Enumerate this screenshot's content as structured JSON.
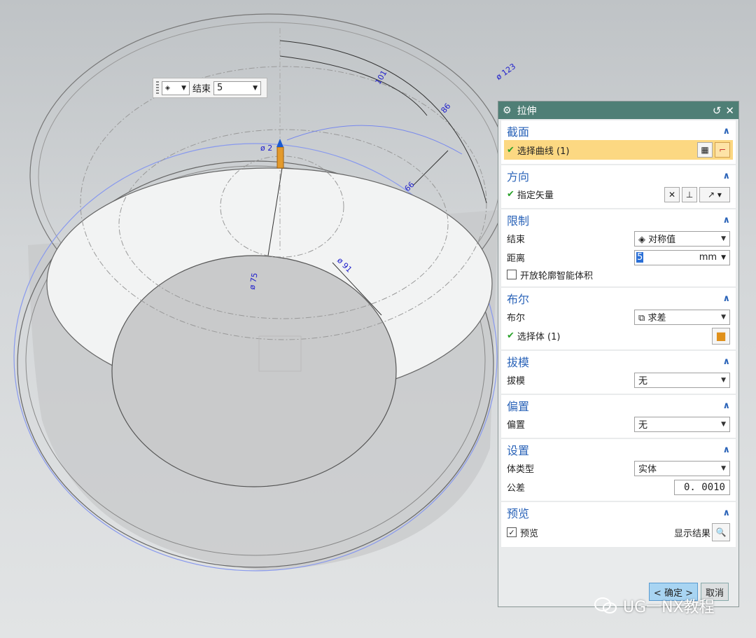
{
  "floating_toolbar": {
    "label": "结束",
    "value": "5"
  },
  "dimensions": {
    "d123": "ø 123",
    "d101": "101",
    "d86": "86",
    "d66": "66",
    "d2": "ø 2",
    "d75": "ø 75",
    "d91": "ø 91"
  },
  "dialog": {
    "title": "拉伸",
    "title_icons": [
      "gear-icon",
      "reset-icon",
      "close-icon"
    ],
    "sections": {
      "section_head": {
        "title": "截面",
        "select_curve": "选择曲线 (1)"
      },
      "direction": {
        "title": "方向",
        "specify_vector": "指定矢量"
      },
      "limits": {
        "title": "限制",
        "end_label": "结束",
        "end_value": "对称值",
        "distance_label": "距离",
        "distance_value": "5",
        "distance_unit": "mm",
        "open_profile_label": "开放轮廓智能体积",
        "open_profile_checked": false
      },
      "boolean": {
        "title": "布尔",
        "boolean_label": "布尔",
        "boolean_value": "求差",
        "select_body": "选择体 (1)"
      },
      "draft": {
        "title": "拔模",
        "draft_label": "拔模",
        "draft_value": "无"
      },
      "offset": {
        "title": "偏置",
        "offset_label": "偏置",
        "offset_value": "无"
      },
      "settings": {
        "title": "设置",
        "body_type_label": "体类型",
        "body_type_value": "实体",
        "tolerance_label": "公差",
        "tolerance_value": "0. 0010"
      },
      "preview": {
        "title": "预览",
        "preview_label": "预览",
        "preview_checked": true,
        "show_result_label": "显示结果"
      }
    },
    "buttons": {
      "ok": "< 确定 >",
      "cancel": "取消"
    }
  },
  "watermark": {
    "text": "UG一NX教程"
  },
  "colors": {
    "title_bar": "#4f7f76",
    "section_title": "#2a63b8",
    "selection_highlight": "#fcd882",
    "dimension_text": "#1d1dcc"
  }
}
